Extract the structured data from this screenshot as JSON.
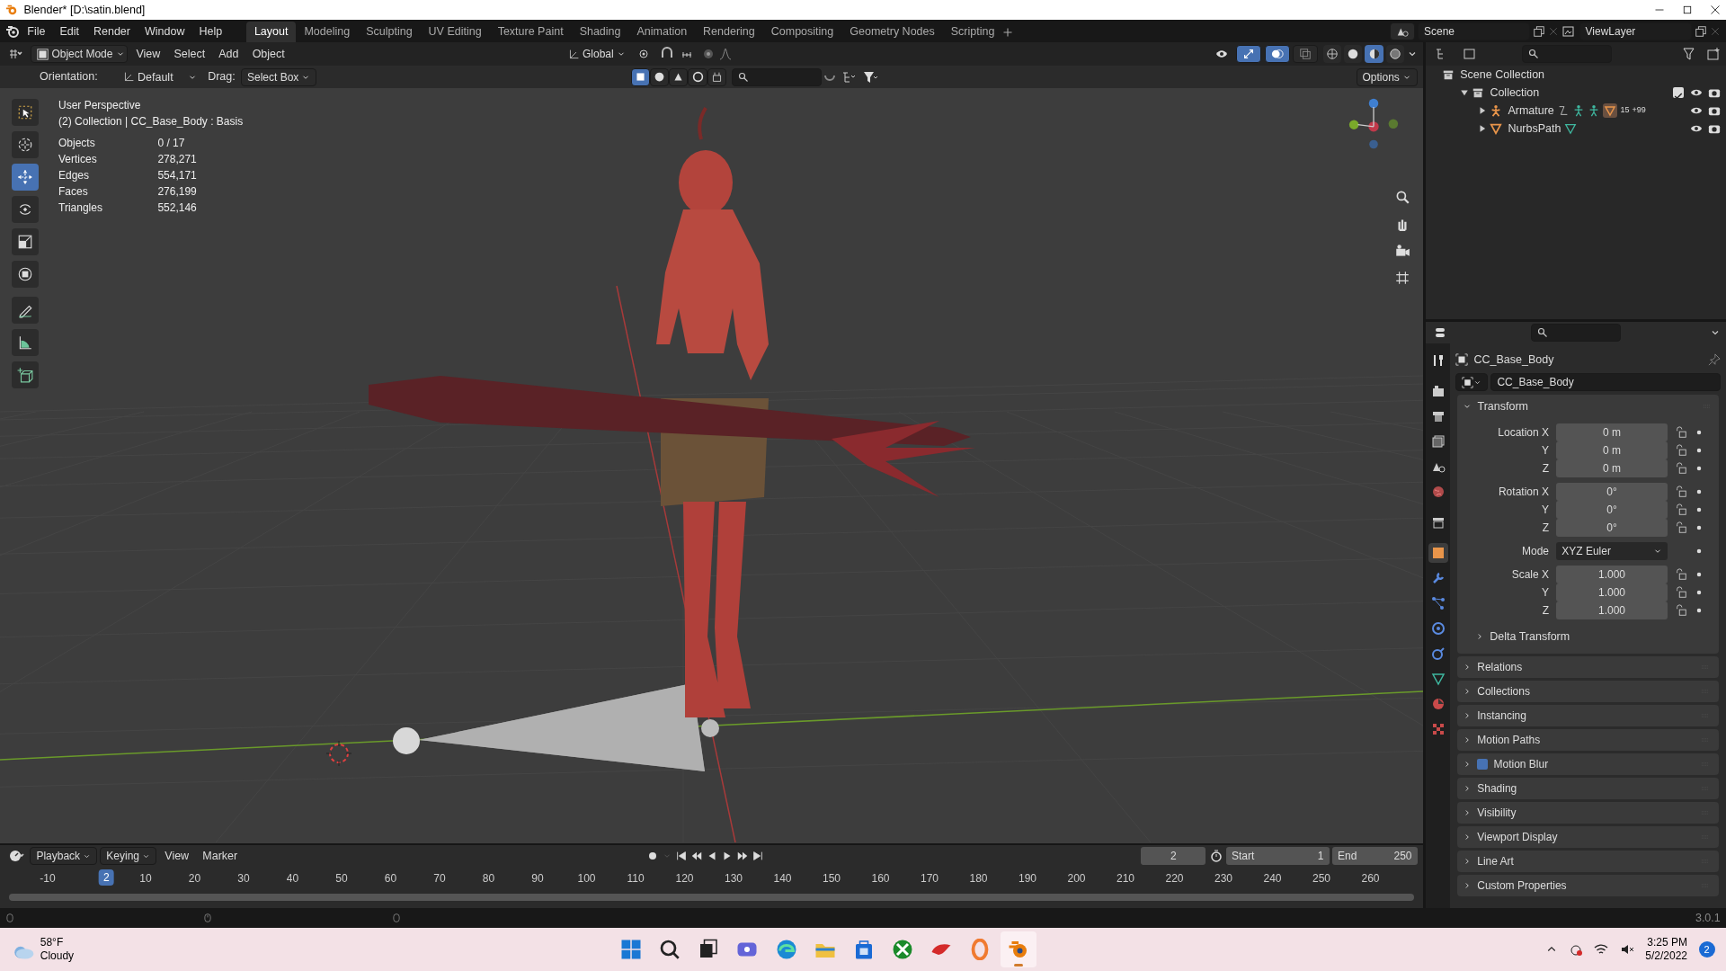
{
  "window": {
    "title": "Blender* [D:\\satin.blend]"
  },
  "menu": [
    "File",
    "Edit",
    "Render",
    "Window",
    "Help"
  ],
  "workspaces": [
    {
      "label": "Layout",
      "selected": true
    },
    {
      "label": "Modeling",
      "selected": false
    },
    {
      "label": "Sculpting",
      "selected": false
    },
    {
      "label": "UV Editing",
      "selected": false
    },
    {
      "label": "Texture Paint",
      "selected": false
    },
    {
      "label": "Shading",
      "selected": false
    },
    {
      "label": "Animation",
      "selected": false
    },
    {
      "label": "Rendering",
      "selected": false
    },
    {
      "label": "Compositing",
      "selected": false
    },
    {
      "label": "Geometry Nodes",
      "selected": false
    },
    {
      "label": "Scripting",
      "selected": false
    }
  ],
  "scene": "Scene",
  "view_layer": "ViewLayer",
  "viewport_header": {
    "mode": "Object Mode",
    "menus": [
      "View",
      "Select",
      "Add",
      "Object"
    ],
    "transform_orientation": "Global",
    "toggles": [
      {
        "kind": "gizmo",
        "on": true
      },
      {
        "kind": "overlay",
        "on": true
      },
      {
        "kind": "xray",
        "on": false
      }
    ],
    "shading_modes": [
      {
        "kind": "wireframe",
        "selected": false
      },
      {
        "kind": "solid",
        "selected": false
      },
      {
        "kind": "material",
        "selected": true
      },
      {
        "kind": "rendered",
        "selected": false
      }
    ]
  },
  "tool_settings": {
    "orientation_label": "Orientation:",
    "orientation": "Default",
    "drag_label": "Drag:",
    "drag": "Select Box",
    "options": "Options",
    "select_modes": [
      {
        "selected": true
      },
      {
        "selected": false
      },
      {
        "selected": false
      },
      {
        "selected": false
      },
      {
        "selected": false
      }
    ]
  },
  "toolbar": [
    {
      "kind": "select",
      "selected": false
    },
    {
      "kind": "cursor",
      "selected": false
    },
    {
      "kind": "move",
      "selected": true
    },
    {
      "kind": "rotate",
      "selected": false
    },
    {
      "kind": "scale",
      "selected": false
    },
    {
      "kind": "transform",
      "selected": false
    },
    {
      "kind": "annotate",
      "selected": false
    },
    {
      "kind": "measure",
      "selected": false
    },
    {
      "kind": "add-cube",
      "selected": false
    }
  ],
  "overlay": {
    "view": "User Perspective",
    "context": "(2) Collection | CC_Base_Body : Basis",
    "stats": [
      {
        "label": "Objects",
        "value": "0 / 17"
      },
      {
        "label": "Vertices",
        "value": "278,271"
      },
      {
        "label": "Edges",
        "value": "554,171"
      },
      {
        "label": "Faces",
        "value": "276,199"
      },
      {
        "label": "Triangles",
        "value": "552,146"
      }
    ]
  },
  "outliner": {
    "items": [
      {
        "label": "Scene Collection",
        "kind": "scene",
        "children": [
          {
            "label": "Collection",
            "kind": "collection",
            "expanded": true,
            "checked": true,
            "children": [
              {
                "label": "Armature",
                "kind": "armature",
                "expanded": false,
                "badges": [
                  "15",
                  "+99"
                ]
              },
              {
                "label": "NurbsPath",
                "kind": "curve",
                "expanded": false
              }
            ]
          }
        ]
      }
    ]
  },
  "properties": {
    "object_name": "CC_Base_Body",
    "datablock": "CC_Base_Body",
    "transform": {
      "title": "Transform",
      "expanded": true,
      "rows": [
        {
          "label": "Location X",
          "value": "0 m",
          "kind": "number"
        },
        {
          "label": "Y",
          "value": "0 m",
          "kind": "number"
        },
        {
          "label": "Z",
          "value": "0 m",
          "kind": "number"
        },
        {
          "label": "Rotation X",
          "value": "0°",
          "kind": "number"
        },
        {
          "label": "Y",
          "value": "0°",
          "kind": "number"
        },
        {
          "label": "Z",
          "value": "0°",
          "kind": "number"
        },
        {
          "label": "Mode",
          "value": "XYZ Euler",
          "kind": "dropdown"
        },
        {
          "label": "Scale X",
          "value": "1.000",
          "kind": "number"
        },
        {
          "label": "Y",
          "value": "1.000",
          "kind": "number"
        },
        {
          "label": "Z",
          "value": "1.000",
          "kind": "number"
        }
      ],
      "subpanel": {
        "title": "Delta Transform",
        "expanded": false
      }
    },
    "panels": [
      {
        "title": "Relations",
        "kind": "plain"
      },
      {
        "title": "Collections",
        "kind": "plain"
      },
      {
        "title": "Instancing",
        "kind": "plain"
      },
      {
        "title": "Motion Paths",
        "kind": "plain"
      },
      {
        "title": "Motion Blur",
        "kind": "toggle",
        "checked": true
      },
      {
        "title": "Shading",
        "kind": "plain"
      },
      {
        "title": "Visibility",
        "kind": "plain"
      },
      {
        "title": "Viewport Display",
        "kind": "plain"
      },
      {
        "title": "Line Art",
        "kind": "plain"
      },
      {
        "title": "Custom Properties",
        "kind": "plain"
      }
    ]
  },
  "timeline": {
    "menus": [
      "Playback",
      "Keying",
      "View",
      "Marker"
    ],
    "current_frame": "2",
    "start_label": "Start",
    "start": "1",
    "end_label": "End",
    "end": "250",
    "ruler": [
      "-10",
      "10",
      "20",
      "30",
      "40",
      "50",
      "60",
      "70",
      "80",
      "90",
      "100",
      "110",
      "120",
      "130",
      "140",
      "150",
      "160",
      "170",
      "180",
      "190",
      "200",
      "210",
      "220",
      "230",
      "240",
      "250",
      "260"
    ],
    "playhead": "2"
  },
  "status_bar": {
    "version": "3.0.1"
  },
  "taskbar": {
    "temperature": "58°F",
    "weather": "Cloudy",
    "time": "3:25 PM",
    "date": "5/2/2022",
    "notifications": "2",
    "apps": [
      {
        "kind": "start",
        "selected": false
      },
      {
        "kind": "search",
        "selected": false
      },
      {
        "kind": "taskview",
        "selected": false
      },
      {
        "kind": "chat",
        "selected": false
      },
      {
        "kind": "browser",
        "selected": false
      },
      {
        "kind": "folder",
        "selected": false
      },
      {
        "kind": "store",
        "selected": false
      },
      {
        "kind": "xbox",
        "selected": false
      },
      {
        "kind": "redapp",
        "selected": false
      },
      {
        "kind": "ring",
        "selected": false
      },
      {
        "kind": "blender",
        "selected": true
      }
    ]
  }
}
